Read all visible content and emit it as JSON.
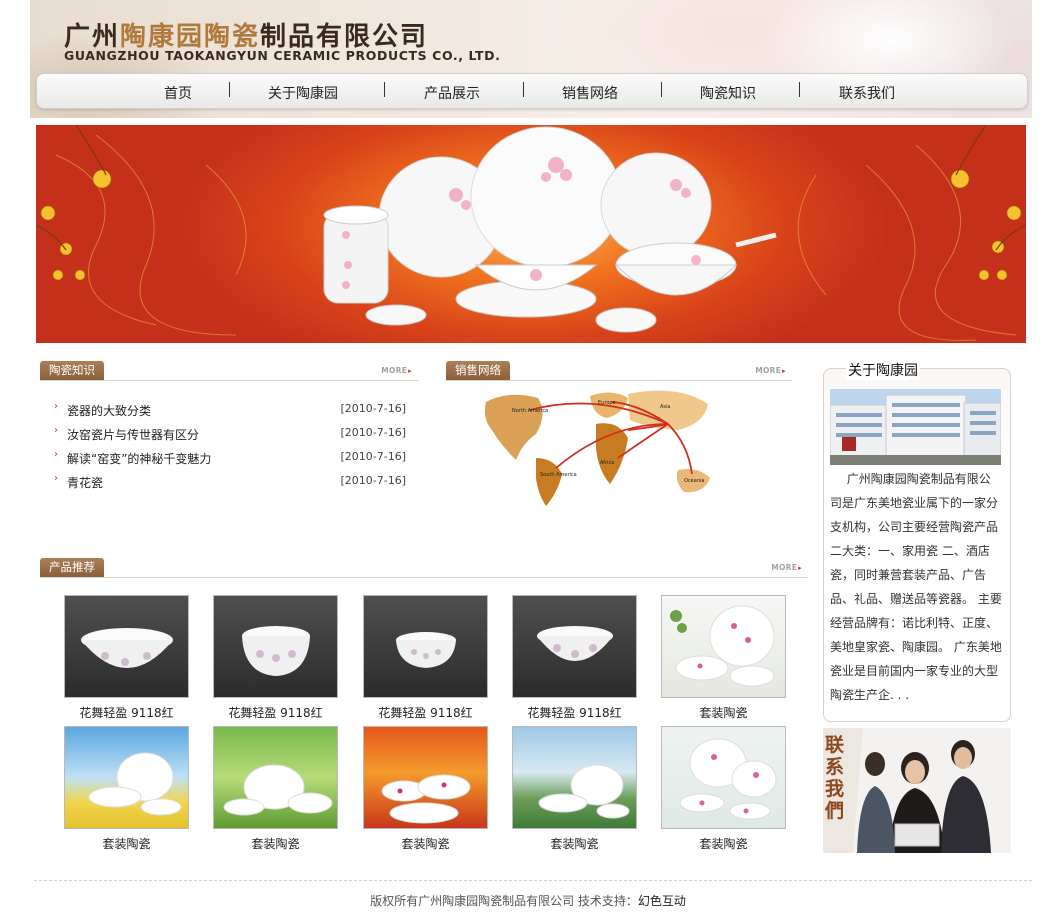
{
  "header": {
    "company_cn_part1": "广州",
    "company_cn_part2": "陶康园陶瓷",
    "company_cn_part3": "制品有限公司",
    "company_en": "GUANGZHOU TAOKANGYUN CERAMIC PRODUCTS CO., LTD."
  },
  "nav": {
    "items": [
      {
        "label": "首页"
      },
      {
        "label": "关于陶康园"
      },
      {
        "label": "产品展示"
      },
      {
        "label": "销售网络"
      },
      {
        "label": "陶瓷知识"
      },
      {
        "label": "联系我们"
      }
    ]
  },
  "knowledge": {
    "title": "陶瓷知识",
    "more": "MORE",
    "items": [
      {
        "title": "瓷器的大致分类",
        "date": "[2010-7-16]"
      },
      {
        "title": "汝窑瓷片与传世器有区分",
        "date": "[2010-7-16]"
      },
      {
        "title": "解读“窑变”的神秘千变魅力",
        "date": "[2010-7-16]"
      },
      {
        "title": "青花瓷",
        "date": "[2010-7-16]"
      }
    ]
  },
  "network": {
    "title": "销售网络",
    "more": "MORE",
    "regions": [
      "North America",
      "Europe",
      "Asia",
      "South America",
      "Africa",
      "Oceania"
    ]
  },
  "products": {
    "title": "产品推荐",
    "more": "MORE",
    "items": [
      {
        "caption": "花舞轻盈 9118红"
      },
      {
        "caption": "花舞轻盈 9118红"
      },
      {
        "caption": "花舞轻盈 9118红"
      },
      {
        "caption": "花舞轻盈 9118红"
      },
      {
        "caption": "套装陶瓷"
      },
      {
        "caption": "套装陶瓷"
      },
      {
        "caption": "套装陶瓷"
      },
      {
        "caption": "套装陶瓷"
      },
      {
        "caption": "套装陶瓷"
      },
      {
        "caption": "套装陶瓷"
      }
    ]
  },
  "about": {
    "title": "关于陶康园",
    "text": "广州陶康园陶瓷制品有限公司是广东美地瓷业属下的一家分支机构，公司主要经营陶瓷产品二大类：一、家用瓷 二、酒店瓷，同时兼营套装产品、广告品、礼品、赠送品等瓷器。 主要经营品牌有：诺比利特、正度、美地皇家瓷、陶康园。 广东美地瓷业是目前国内一家专业的大型陶瓷生产企. . ."
  },
  "contact": {
    "label": "联系我們"
  },
  "footer": {
    "copyright": "版权所有广州陶康园陶瓷制品有限公司 技术支持：",
    "support": "幻色互动"
  },
  "colors": {
    "accent_brown": "#8a5f3a",
    "bullet_red": "#c0392b",
    "banner_red": "#d9431a"
  }
}
